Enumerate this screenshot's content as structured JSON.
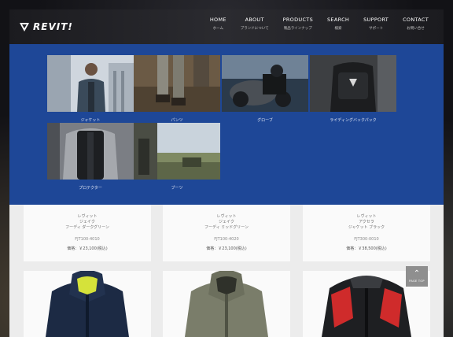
{
  "brand": {
    "name": "REVIT!"
  },
  "nav": [
    {
      "en": "HOME",
      "jp": "ホーム"
    },
    {
      "en": "ABOUT",
      "jp": "ブランドについて"
    },
    {
      "en": "PRODUCTS",
      "jp": "製品ラインナップ"
    },
    {
      "en": "SEARCH",
      "jp": "検索"
    },
    {
      "en": "SUPPORT",
      "jp": "サポート"
    },
    {
      "en": "CONTACT",
      "jp": "お問い合せ"
    }
  ],
  "menu": {
    "categories": [
      {
        "label": "ジャケット",
        "icon": "jacket-photo"
      },
      {
        "label": "パンツ",
        "icon": "pants-photo"
      },
      {
        "label": "グローブ",
        "icon": "gloves-photo"
      },
      {
        "label": "ライディングバックパック",
        "icon": "backpack-photo"
      },
      {
        "label": "プロテクター",
        "icon": "protector-photo"
      },
      {
        "label": "ブーツ",
        "icon": "boots-photo"
      }
    ]
  },
  "products": {
    "top": [
      {
        "name1": "レヴィット",
        "name2": "ジェイク",
        "name3": "フーディ ダークグリーン",
        "code": "FJT100-4010",
        "price": "価格：￥23,100(税込)"
      },
      {
        "name1": "レヴィット",
        "name2": "ジェイク",
        "name3": "フーディ ミッドグリーン",
        "code": "FJT100-4020",
        "price": "価格：￥23,100(税込)"
      },
      {
        "name1": "レヴィット",
        "name2": "アクセラ",
        "name3": "ジャケット ブラック",
        "code": "FJT300-0010",
        "price": "価格：￥38,500(税込)"
      }
    ],
    "bottom": [
      {
        "icon": "navy-hoodie-jacket"
      },
      {
        "icon": "olive-hoodie-jacket"
      },
      {
        "icon": "black-red-riding-jacket"
      }
    ]
  },
  "page_top": {
    "label": "PAGE TOP",
    "arrow": "chevron-up-icon"
  }
}
